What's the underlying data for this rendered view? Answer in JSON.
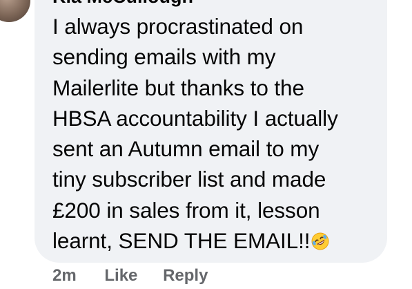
{
  "comment": {
    "author": "Kia McCullough",
    "lines": [
      "I always procrastinated on",
      "sending emails with my",
      "Mailerlite but thanks to the",
      "HBSA accountability I actually",
      "sent an Autumn email to my",
      "tiny subscriber list and made",
      "£200 in sales from it, lesson",
      "learnt, SEND THE EMAIL!!"
    ],
    "emoji_icon": "rolling-on-floor-laughing-emoji"
  },
  "actions": {
    "time": "2m",
    "like_label": "Like",
    "reply_label": "Reply"
  }
}
